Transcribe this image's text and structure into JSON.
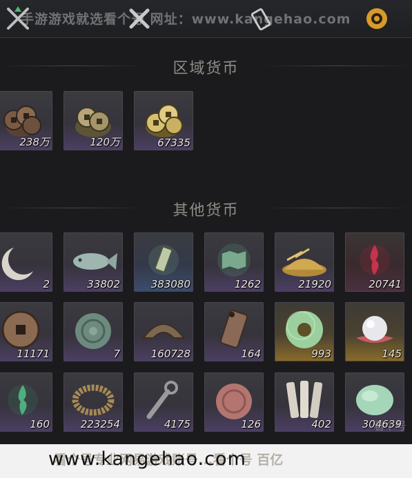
{
  "header": {
    "watermark": "手游游戏就选看个号   网址：www.kangehao.com",
    "tabs": [
      {
        "icon": "crossed-swords-icon"
      },
      {
        "icon": "crossed-blades-icon"
      },
      {
        "icon": "scroll-icon"
      },
      {
        "icon": "gold-coin-tab-icon",
        "active": true
      }
    ]
  },
  "sections": {
    "regional_title": "区域货币",
    "other_title": "其他货币"
  },
  "regional_items": [
    {
      "name": "copper-coin-pile-icon",
      "count": "238万"
    },
    {
      "name": "bronze-coin-pile-icon",
      "count": "120万"
    },
    {
      "name": "gold-coin-pile-icon",
      "count": "67335"
    }
  ],
  "other_items": [
    {
      "name": "crescent-jade-icon",
      "count": "2"
    },
    {
      "name": "jade-fish-icon",
      "count": "33802"
    },
    {
      "name": "jade-tablet-icon",
      "count": "383080"
    },
    {
      "name": "map-scroll-icon",
      "count": "1262"
    },
    {
      "name": "grain-pile-icon",
      "count": "21920"
    },
    {
      "name": "red-flame-sigil-icon",
      "count": "20741"
    },
    {
      "name": "ancient-coin-icon",
      "count": "11171"
    },
    {
      "name": "jade-seal-icon",
      "count": "7"
    },
    {
      "name": "spade-coin-icon",
      "count": "160728"
    },
    {
      "name": "bronze-token-icon",
      "count": "164"
    },
    {
      "name": "jade-bi-disc-icon",
      "count": "993"
    },
    {
      "name": "pearl-icon",
      "count": "145"
    },
    {
      "name": "green-flame-sigil-icon",
      "count": "160"
    },
    {
      "name": "coin-string-icon",
      "count": "223254"
    },
    {
      "name": "key-knife-coin-icon",
      "count": "4175"
    },
    {
      "name": "red-jade-seal-icon",
      "count": "126"
    },
    {
      "name": "bamboo-slips-icon",
      "count": "402"
    },
    {
      "name": "jade-stone-icon",
      "count": "304639"
    }
  ],
  "footer": {
    "url": "www.kangehao.com",
    "ghost_text": "看个号专业网易游戏账号...看个号 百亿",
    "corner_mark": "看个号"
  },
  "colors": {
    "background": "#1b1b1d",
    "card_purple": "#4b3f63",
    "card_gold": "#8a6c2a",
    "count_text": "#ece8e2",
    "tab_active": "#d79a2c"
  }
}
